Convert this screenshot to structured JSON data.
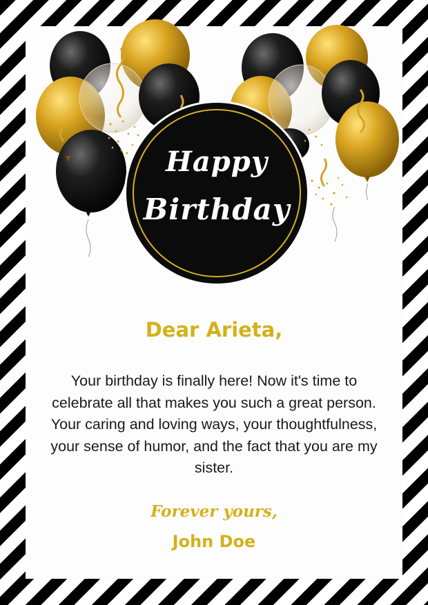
{
  "card": {
    "badge": {
      "line1": "Happy",
      "line2": "Birthday"
    },
    "greeting": "Dear Arieta,",
    "message": "Your birthday is finally here! Now it's time to celebrate all that makes you such a great person. Your caring and loving ways, your thoughtfulness, your sense of humor, and the fact that you are my sister.",
    "closing": "Forever yours,",
    "signature": "John Doe"
  },
  "colors": {
    "gold": "#d4b11a",
    "black": "#0b0b0b",
    "stripe_black": "#000000",
    "stripe_white": "#ffffff"
  },
  "icons": [
    "balloons-icon",
    "confetti-icon"
  ]
}
